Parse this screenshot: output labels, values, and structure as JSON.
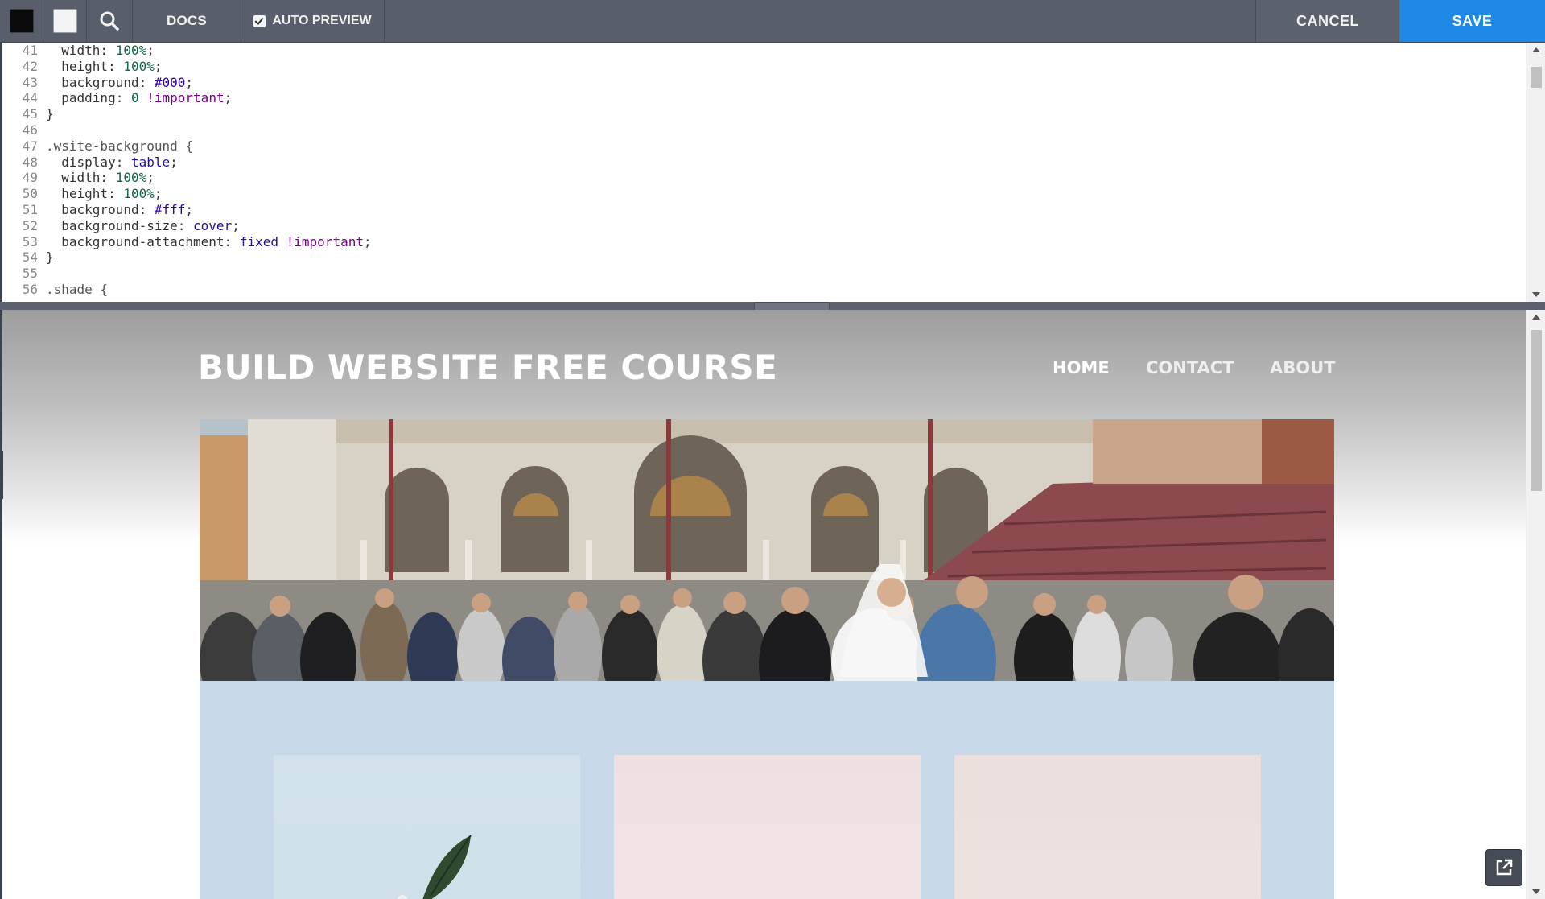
{
  "toolbar": {
    "swatches": [
      {
        "name": "black",
        "color": "#0a0a0a"
      },
      {
        "name": "white",
        "color": "#f4f4f4"
      }
    ],
    "search_icon": "search-icon",
    "docs_label": "DOCS",
    "auto_preview_label": "AUTO PREVIEW",
    "auto_preview_checked": true,
    "cancel_label": "CANCEL",
    "save_label": "SAVE",
    "save_color": "#1e88e5"
  },
  "editor": {
    "lines": [
      {
        "n": "41",
        "text": "  width: 100%;"
      },
      {
        "n": "42",
        "text": "  height: 100%;"
      },
      {
        "n": "43",
        "text": "  background: #000;"
      },
      {
        "n": "44",
        "text": "  padding: 0 !important;"
      },
      {
        "n": "45",
        "text": "}"
      },
      {
        "n": "46",
        "text": ""
      },
      {
        "n": "47",
        "text": ".wsite-background {"
      },
      {
        "n": "48",
        "text": "  display: table;"
      },
      {
        "n": "49",
        "text": "  width: 100%;"
      },
      {
        "n": "50",
        "text": "  height: 100%;"
      },
      {
        "n": "51",
        "text": "  background: #fff;"
      },
      {
        "n": "52",
        "text": "  background-size: cover;"
      },
      {
        "n": "53",
        "text": "  background-attachment: fixed !important;"
      },
      {
        "n": "54",
        "text": "}"
      },
      {
        "n": "55",
        "text": ""
      },
      {
        "n": "56",
        "text": ".shade {"
      }
    ]
  },
  "preview": {
    "site_title": "BUILD WEBSITE FREE COURSE",
    "nav": {
      "home": "HOME",
      "contact": "CONTACT",
      "about": "ABOUT"
    },
    "popout_icon": "external-link-icon"
  }
}
